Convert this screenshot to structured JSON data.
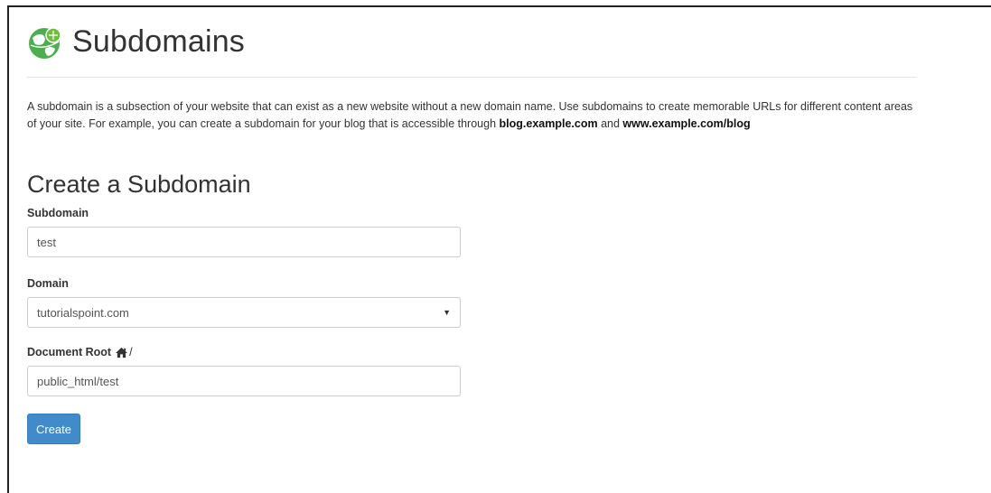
{
  "header": {
    "title": "Subdomains"
  },
  "description": {
    "text": "A subdomain is a subsection of your website that can exist as a new website without a new domain name. Use subdomains to create memorable URLs for different content areas of your site. For example, you can create a subdomain for your blog that is accessible through",
    "example1": "blog.example.com",
    "and": "and",
    "example2": "www.example.com/blog"
  },
  "form": {
    "section_title": "Create a Subdomain",
    "subdomain_label": "Subdomain",
    "subdomain_value": "test",
    "domain_label": "Domain",
    "domain_selected": "tutorialspoint.com",
    "docroot_label": "Document Root",
    "docroot_suffix": "/",
    "docroot_value": "public_html/test",
    "create_label": "Create"
  },
  "icons": {
    "logo": "subdomains-globe-icon",
    "home": "home-icon",
    "caret": "caret-down-icon"
  },
  "colors": {
    "accent": "#428bca",
    "logo_green": "#5cb85c"
  }
}
